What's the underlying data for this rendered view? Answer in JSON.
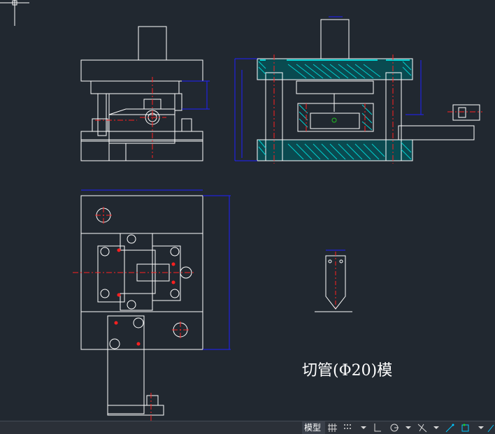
{
  "drawing": {
    "title": "切管(Φ20)模"
  },
  "statusbar": {
    "model_tab": "模型",
    "icons": [
      "grid-icon",
      "snap-icon",
      "ortho-icon",
      "polar-icon",
      "osnap-icon",
      "workspace-icon"
    ]
  },
  "colors": {
    "background": "#212830",
    "line": "#ffffff",
    "center": "#ff2020",
    "dimension": "#2020ff",
    "hatch": "#00d0d0",
    "accent": "#00c8ff"
  }
}
